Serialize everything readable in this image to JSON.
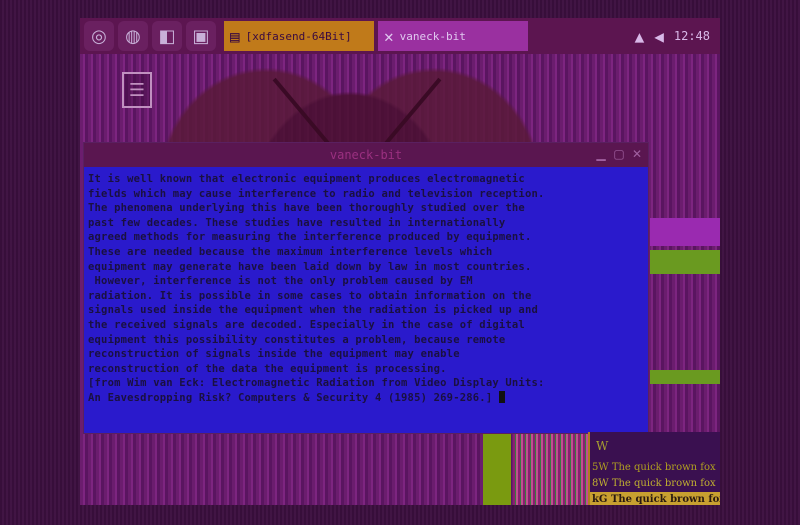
{
  "taskbar": {
    "launchers": [
      {
        "icon": "menu-icon",
        "glyph": "◎"
      },
      {
        "icon": "browser-icon",
        "glyph": "◍"
      },
      {
        "icon": "tool-icon",
        "glyph": "◧"
      },
      {
        "icon": "terminal-icon",
        "glyph": "▣"
      }
    ],
    "tasks": [
      {
        "label": "[xdfasend-64Bit]",
        "icon": "terminal-task-icon",
        "glyph": "▤"
      },
      {
        "label": "vaneck-bit",
        "icon": "x-app-icon",
        "glyph": "✕"
      }
    ],
    "tray": {
      "glyph_arrow": "▲",
      "glyph_sound": "◀",
      "clock": "12:48"
    }
  },
  "desktop": {
    "icon_glyph": "☰"
  },
  "terminal": {
    "title": "vaneck-bit",
    "lines": [
      "It is well known that electronic equipment produces electromagnetic",
      "fields which may cause interference to radio and television reception.",
      "The phenomena underlying this have been thoroughly studied over the",
      "past few decades. These studies have resulted in internationally",
      "agreed methods for measuring the interference produced by equipment.",
      "These are needed because the maximum interference levels which",
      "equipment may generate have been laid down by law in most countries.",
      " However, interference is not the only problem caused by EM",
      "radiation. It is possible in some cases to obtain information on the",
      "signals used inside the equipment when the radiation is picked up and",
      "the received signals are decoded. Especially in the case of digital",
      "equipment this possibility constitutes a problem, because remote",
      "reconstruction of signals inside the equipment may enable",
      "reconstruction of the data the equipment is processing.",
      "[from Wim van Eck: Electromagnetic Radiation from Video Display Units:",
      "An Eavesdropping Risk? Computers & Security 4 (1985) 269-286.] "
    ]
  },
  "xfont": {
    "header": "W",
    "lines": [
      "5W The quick brown fox",
      "8W The quick brown fox",
      "kG The quick brown fox"
    ]
  }
}
